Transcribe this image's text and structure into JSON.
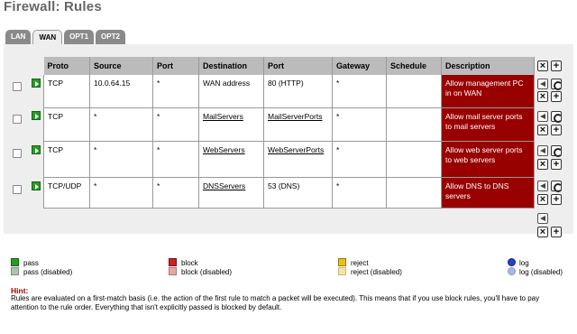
{
  "page": {
    "title": "Firewall: Rules"
  },
  "tabs": [
    {
      "label": "LAN",
      "active": false
    },
    {
      "label": "WAN",
      "active": true
    },
    {
      "label": "OPT1",
      "active": false
    },
    {
      "label": "OPT2",
      "active": false
    }
  ],
  "table": {
    "headers": [
      "Proto",
      "Source",
      "Port",
      "Destination",
      "Port",
      "Gateway",
      "Schedule",
      "Description"
    ],
    "rows": [
      {
        "proto": "TCP",
        "source": "10.0.64.15",
        "src_port": "*",
        "destination": "WAN address",
        "dst_port": "80 (HTTP)",
        "gateway": "*",
        "schedule": "",
        "description": "Allow management PC in on WAN"
      },
      {
        "proto": "TCP",
        "source": "*",
        "src_port": "*",
        "destination": "MailServers",
        "dst_port": "MailServerPorts",
        "gateway": "*",
        "schedule": "",
        "description": "Allow mail server ports to mail servers"
      },
      {
        "proto": "TCP",
        "source": "*",
        "src_port": "*",
        "destination": "WebServers",
        "dst_port": "WebServerPorts",
        "gateway": "*",
        "schedule": "",
        "description": "Allow web server ports to web servers"
      },
      {
        "proto": "TCP/UDP",
        "source": "*",
        "src_port": "*",
        "destination": "DNSServers",
        "dst_port": "53 (DNS)",
        "gateway": "*",
        "schedule": "",
        "description": "Allow DNS to DNS servers"
      }
    ]
  },
  "legend": {
    "pass": "pass",
    "pass_disabled": "pass (disabled)",
    "block": "block",
    "block_disabled": "block (disabled)",
    "reject": "reject",
    "reject_disabled": "reject (disabled)",
    "log": "log",
    "log_disabled": "log (disabled)"
  },
  "hint": {
    "title": "Hint:",
    "text": "Rules are evaluated on a first-match basis (i.e. the action of the first rule to match a packet will be executed). This means that if you use block rules, you'll have to pay attention to the rule order. Everything that isn't explicitly passed is blocked by default."
  },
  "colors": {
    "title": "#666666",
    "description_bg": "#990000",
    "header_bg": "#bbbbbb",
    "panel_bg": "#eeeeee",
    "hint_title": "#990000"
  },
  "icons": {
    "rule_type": "pass-arrow-icon",
    "edit": "edit-icon",
    "delete": "delete-icon",
    "add": "add-icon",
    "move_before": "move-before-icon"
  }
}
